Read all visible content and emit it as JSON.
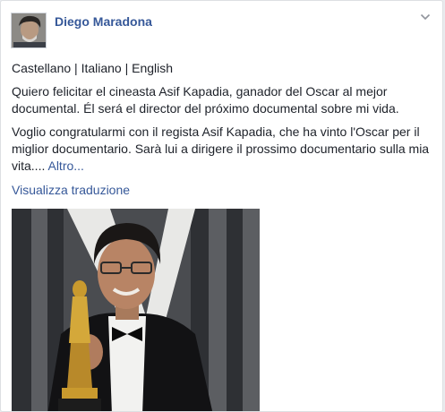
{
  "post": {
    "author": "Diego Maradona",
    "languages": "Castellano | Italiano | English",
    "spanish_text": "Quiero felicitar el cineasta Asif Kapadia, ganador del Oscar al mejor documental. Él será el director del próximo documental sobre mi vida.",
    "italian_text": "Voglio congratularmi con il regista Asif Kapadia, che ha vinto l'Oscar per il miglior documentario. Sarà lui a dirigere il prossimo documentario sulla mia vita....",
    "more_label": "Altro...",
    "translate_label": "Visualizza traduzione",
    "options_icon": "chevron-down-icon",
    "avatar_icon": "profile-photo",
    "photo_icon": "post-photo"
  },
  "colors": {
    "link": "#365899",
    "text": "#1d2129",
    "muted": "#90949c",
    "background": "#e9ebee"
  }
}
